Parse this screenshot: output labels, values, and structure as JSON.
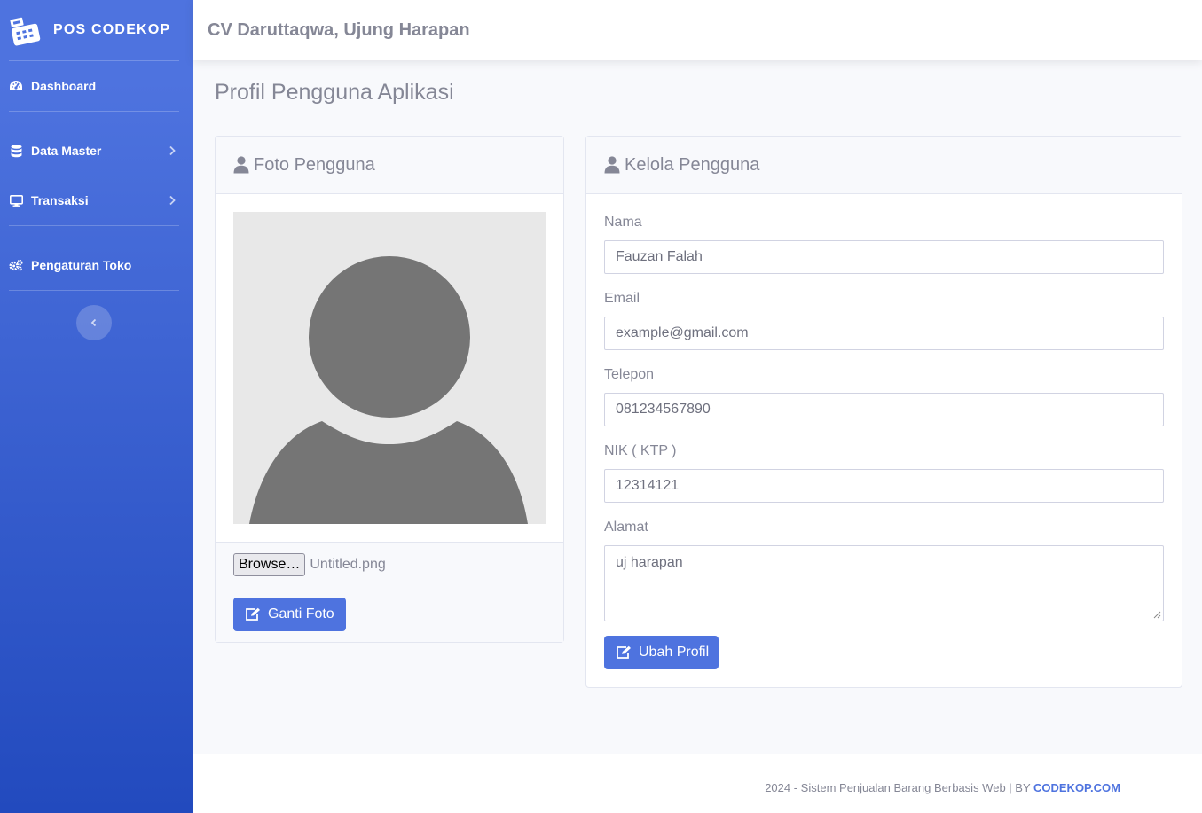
{
  "sidebar": {
    "brand": "POS CODEKOP",
    "items": [
      {
        "label": "Dashboard",
        "icon": "tachometer-icon",
        "has_arrow": false
      },
      {
        "label": "Data Master",
        "icon": "database-icon",
        "has_arrow": true
      },
      {
        "label": "Transaksi",
        "icon": "desktop-icon",
        "has_arrow": true
      },
      {
        "label": "Pengaturan Toko",
        "icon": "cogs-icon",
        "has_arrow": false
      }
    ]
  },
  "topbar": {
    "title": "CV Daruttaqwa, Ujung Harapan"
  },
  "page": {
    "title": "Profil Pengguna Aplikasi"
  },
  "photo_card": {
    "title": "Foto Pengguna",
    "browse_label": "Browse…",
    "file_name": "Untitled.png",
    "button_label": "Ganti Foto"
  },
  "profile_card": {
    "title": "Kelola Pengguna",
    "fields": {
      "nama": {
        "label": "Nama",
        "value": "Fauzan Falah"
      },
      "email": {
        "label": "Email",
        "value": "example@gmail.com"
      },
      "telepon": {
        "label": "Telepon",
        "value": "081234567890"
      },
      "nik": {
        "label": "NIK ( KTP )",
        "value": "12314121"
      },
      "alamat": {
        "label": "Alamat",
        "value": "uj harapan"
      }
    },
    "button_label": "Ubah Profil"
  },
  "footer": {
    "text": "2024 - Sistem Penjualan Barang Berbasis Web | BY ",
    "link": "CODEKOP.COM"
  },
  "colors": {
    "primary": "#4e73df",
    "sidebar_top": "#4e73df",
    "sidebar_bottom": "#224abe",
    "text_muted": "#858796"
  }
}
